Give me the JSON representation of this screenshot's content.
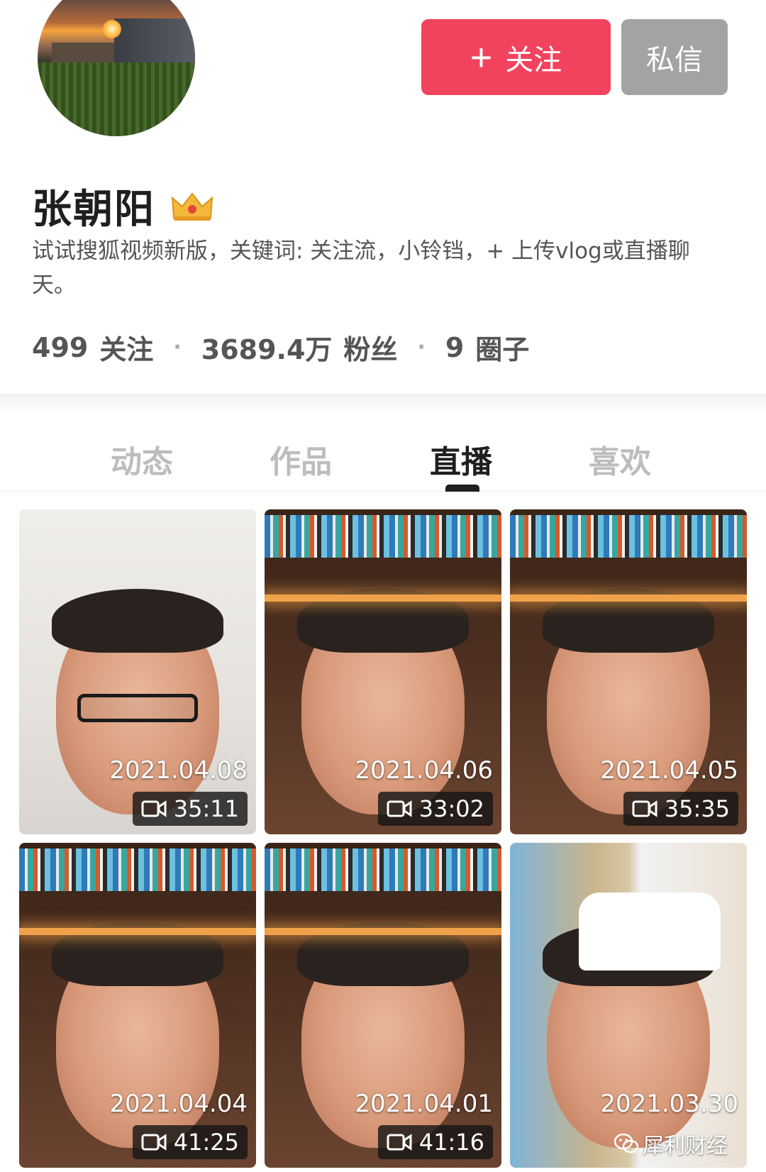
{
  "profile": {
    "name": "张朝阳",
    "bio": "试试搜狐视频新版，关键词: 关注流，小铃铛，+ 上传vlog或直播聊天。",
    "follow_label": "关注",
    "message_label": "私信",
    "stats": [
      {
        "num": "499",
        "label": "关注"
      },
      {
        "num": "3689.4万",
        "label": "粉丝"
      },
      {
        "num": "9",
        "label": "圈子"
      }
    ],
    "stat_sep": "·"
  },
  "tabs": [
    {
      "label": "动态",
      "active": false
    },
    {
      "label": "作品",
      "active": false
    },
    {
      "label": "直播",
      "active": true
    },
    {
      "label": "喜欢",
      "active": false
    }
  ],
  "videos": [
    {
      "date": "2021.04.08",
      "duration": "35:11"
    },
    {
      "date": "2021.04.06",
      "duration": "33:02"
    },
    {
      "date": "2021.04.05",
      "duration": "35:35"
    },
    {
      "date": "2021.04.04",
      "duration": "41:25"
    },
    {
      "date": "2021.04.01",
      "duration": "41:16"
    },
    {
      "date": "2021.03.30",
      "duration": ""
    }
  ],
  "watermark": {
    "text": "犀利财经",
    "icon": "wechat-icon"
  },
  "colors": {
    "follow": "#f2435e",
    "message": "#a3a3a3",
    "active_tab": "#1f1f1f",
    "inactive_tab": "#bdbdbd"
  }
}
